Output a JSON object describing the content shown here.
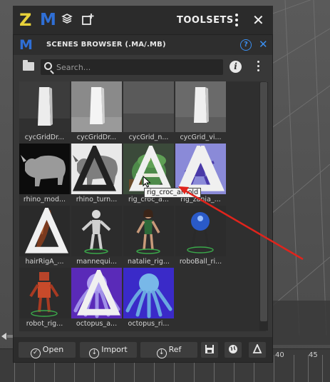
{
  "toolsets": {
    "logo_z": "Z",
    "logo_m": "M",
    "title": "TOOLSETS"
  },
  "browser": {
    "logo_m": "M",
    "title": "SCENES BROWSER (.MA/.MB)",
    "help_glyph": "?",
    "info_glyph": "i",
    "search": {
      "placeholder": "Search...",
      "value": ""
    },
    "tooltip": "rig_croc_arnold",
    "tiles": [
      {
        "label": "cycGridDr...",
        "thumb": "white-column-dark",
        "arnold": false
      },
      {
        "label": "cycGridDr...",
        "thumb": "white-column-light",
        "arnold": false
      },
      {
        "label": "cycGrid_n...",
        "thumb": "grey-backdrop",
        "arnold": false
      },
      {
        "label": "cycGrid_vi...",
        "thumb": "white-column-mid",
        "arnold": false
      },
      {
        "label": "rhino_mod...",
        "thumb": "rhino-dark",
        "arnold": false
      },
      {
        "label": "rhino_turn...",
        "thumb": "rhino-light",
        "arnold": true
      },
      {
        "label": "rig_croc_a...",
        "thumb": "croc",
        "arnold": true
      },
      {
        "label": "rig_zania_...",
        "thumb": "alien",
        "arnold": true
      },
      {
        "label": "hairRigA_...",
        "thumb": "hair",
        "arnold": true
      },
      {
        "label": "mannequi...",
        "thumb": "mannequin",
        "arnold": false
      },
      {
        "label": "natalie_rig...",
        "thumb": "natalie",
        "arnold": false
      },
      {
        "label": "roboBall_ri...",
        "thumb": "roboball",
        "arnold": false
      },
      {
        "label": "robot_rig...",
        "thumb": "robot",
        "arnold": false
      },
      {
        "label": "octopus_a...",
        "thumb": "octopus-purple",
        "arnold": true
      },
      {
        "label": "octopus_ri...",
        "thumb": "octopus-blue",
        "arnold": false
      }
    ],
    "buttons": {
      "open": "Open",
      "import": "Import",
      "ref": "Ref"
    }
  },
  "timeline": {
    "ticks": [
      "40",
      "45"
    ]
  },
  "colors": {
    "maya_blue": "#2f6fd6",
    "zoo_yellow": "#e8d23a",
    "accent_blue": "#3b8ff0",
    "annotation_red": "#e0241c"
  },
  "icons": {
    "toolbar": [
      "zoo-z-logo",
      "maya-m-logo",
      "shelf-icon",
      "new-window-icon",
      "more-vert-icon",
      "close-icon"
    ],
    "browser_header": [
      "maya-m-logo",
      "help-icon",
      "close-icon"
    ],
    "search_row": [
      "folder-icon",
      "search-icon",
      "info-icon",
      "more-vert-icon"
    ],
    "bottom": [
      "check-circle-icon",
      "arrow-down-circle-icon",
      "save-icon",
      "globe-icon",
      "arnold-icon"
    ]
  }
}
